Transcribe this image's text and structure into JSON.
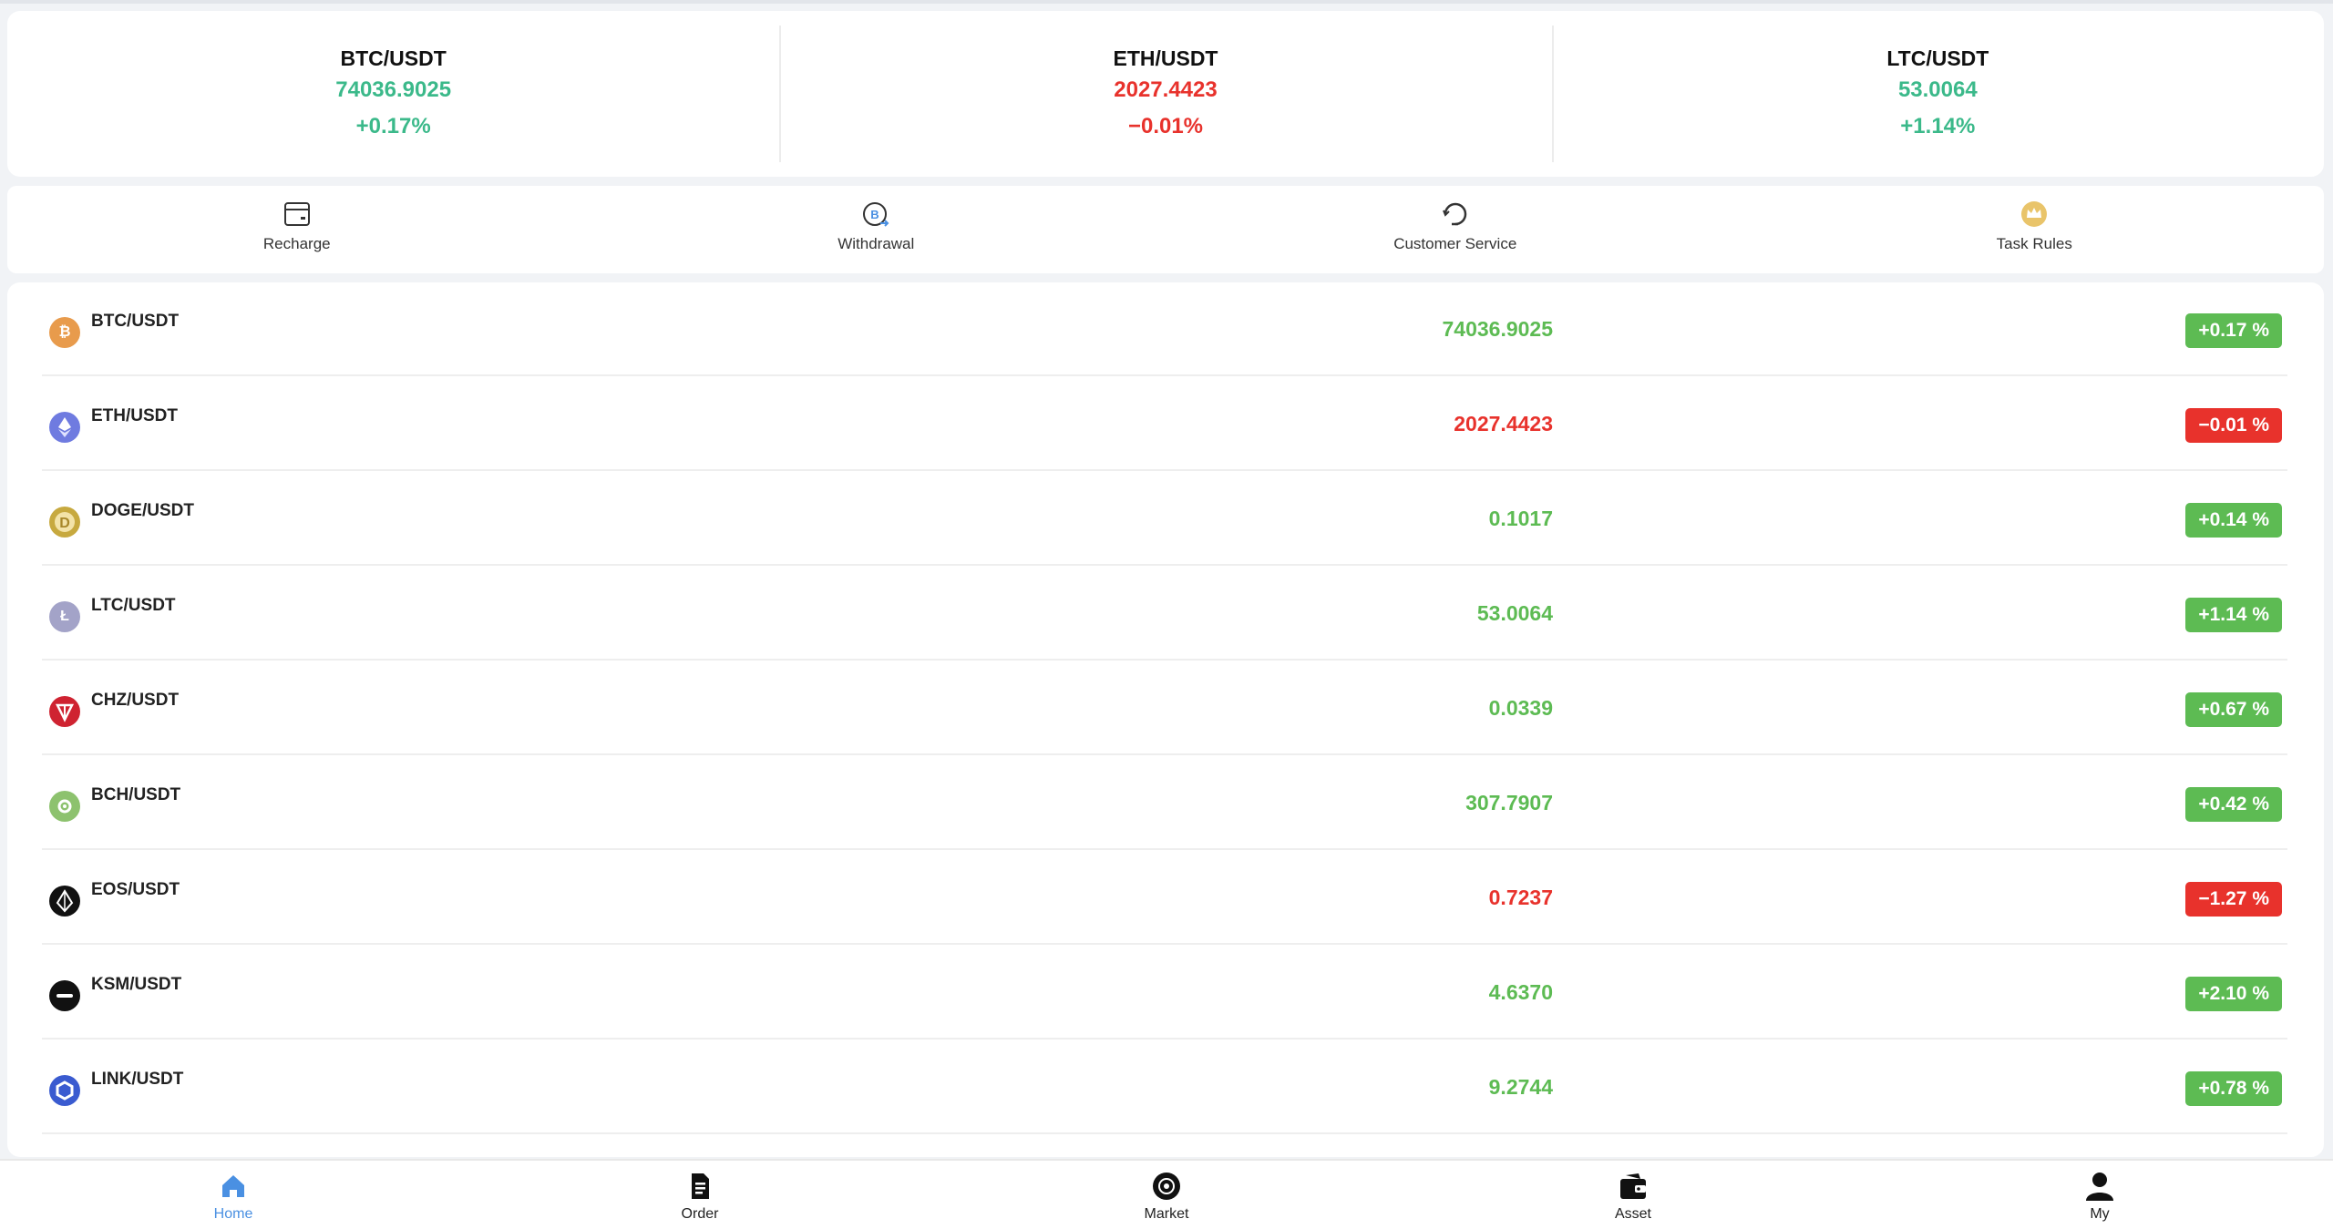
{
  "tickers": [
    {
      "pair": "BTC/USDT",
      "price": "74036.9025",
      "change": "+0.17%",
      "dir": "up"
    },
    {
      "pair": "ETH/USDT",
      "price": "2027.4423",
      "change": "−0.01%",
      "dir": "down"
    },
    {
      "pair": "LTC/USDT",
      "price": "53.0064",
      "change": "+1.14%",
      "dir": "up"
    }
  ],
  "actions": [
    {
      "label": "Recharge",
      "icon": "wallet-card-icon"
    },
    {
      "label": "Withdrawal",
      "icon": "bitcoin-withdraw-icon"
    },
    {
      "label": "Customer Service",
      "icon": "headset-refresh-icon"
    },
    {
      "label": "Task Rules",
      "icon": "crown-icon"
    }
  ],
  "market": [
    {
      "pair": "BTC/USDT",
      "price": "74036.9025",
      "change": "+0.17 %",
      "dir": "up",
      "icon": "btc-coin-icon",
      "color": "#e89b4c"
    },
    {
      "pair": "ETH/USDT",
      "price": "2027.4423",
      "change": "−0.01 %",
      "dir": "down",
      "icon": "eth-coin-icon",
      "color": "#6f7be0"
    },
    {
      "pair": "DOGE/USDT",
      "price": "0.1017",
      "change": "+0.14 %",
      "dir": "up",
      "icon": "doge-coin-icon",
      "color": "#c7a93f"
    },
    {
      "pair": "LTC/USDT",
      "price": "53.0064",
      "change": "+1.14 %",
      "dir": "up",
      "icon": "ltc-coin-icon",
      "color": "#a3a3c8"
    },
    {
      "pair": "CHZ/USDT",
      "price": "0.0339",
      "change": "+0.67 %",
      "dir": "up",
      "icon": "chz-coin-icon",
      "color": "#cf2331"
    },
    {
      "pair": "BCH/USDT",
      "price": "307.7907",
      "change": "+0.42 %",
      "dir": "up",
      "icon": "bch-coin-icon",
      "color": "#8dc26e"
    },
    {
      "pair": "EOS/USDT",
      "price": "0.7237",
      "change": "−1.27 %",
      "dir": "down",
      "icon": "eos-coin-icon",
      "color": "#111111"
    },
    {
      "pair": "KSM/USDT",
      "price": "4.6370",
      "change": "+2.10 %",
      "dir": "up",
      "icon": "ksm-coin-icon",
      "color": "#111111"
    },
    {
      "pair": "LINK/USDT",
      "price": "9.2744",
      "change": "+0.78 %",
      "dir": "up",
      "icon": "link-coin-icon",
      "color": "#3a5bd0"
    }
  ],
  "tabs": [
    {
      "label": "Home",
      "icon": "home-icon",
      "active": true
    },
    {
      "label": "Order",
      "icon": "document-icon",
      "active": false
    },
    {
      "label": "Market",
      "icon": "market-icon",
      "active": false
    },
    {
      "label": "Asset",
      "icon": "wallet-icon",
      "active": false
    },
    {
      "label": "My",
      "icon": "user-icon",
      "active": false
    }
  ],
  "colors": {
    "up": "#5dbb53",
    "down": "#e8322c",
    "ticker_up": "#3bb98a",
    "accent": "#4a90e2"
  }
}
